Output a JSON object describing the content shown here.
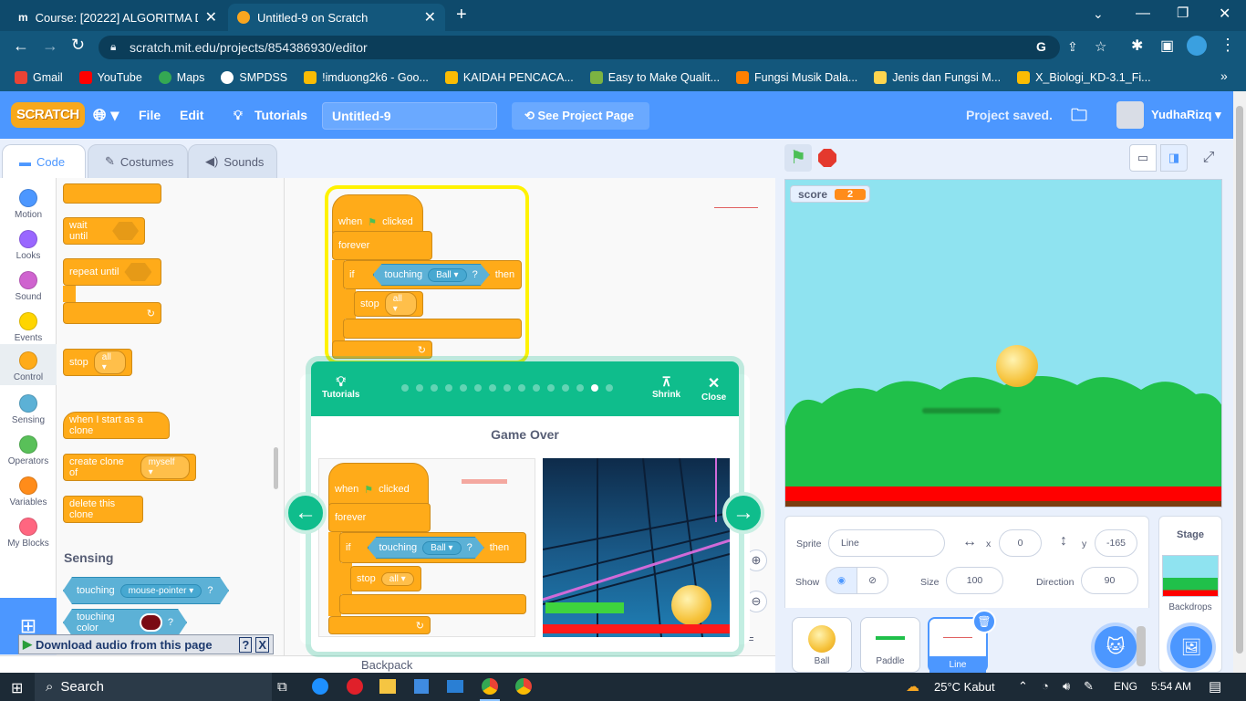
{
  "browser": {
    "tabs": [
      {
        "title": "Course: [20222] ALGORITMA DAN",
        "icon": "moodle-icon"
      },
      {
        "title": "Untitled-9 on Scratch",
        "icon": "scratch-icon"
      }
    ],
    "url": "scratch.mit.edu/projects/854386930/editor",
    "bookmarks": [
      "Gmail",
      "YouTube",
      "Maps",
      "SMPDSS",
      "!imduong2k6 - Goo...",
      "KAIDAH PENCACA...",
      "Easy to Make Qualit...",
      "Fungsi Musik Dala...",
      "Jenis dan Fungsi M...",
      "X_Biologi_KD-3.1_Fi..."
    ]
  },
  "menubar": {
    "logo": "SCRATCH",
    "file": "File",
    "edit": "Edit",
    "tutorials": "Tutorials",
    "project_title": "Untitled-9",
    "see_project": "See Project Page",
    "saved": "Project saved.",
    "username": "YudhaRizq"
  },
  "editor_tabs": {
    "code": "Code",
    "costumes": "Costumes",
    "sounds": "Sounds"
  },
  "categories": [
    {
      "label": "Motion",
      "color": "#4c97ff"
    },
    {
      "label": "Looks",
      "color": "#9966ff"
    },
    {
      "label": "Sound",
      "color": "#cf63cf"
    },
    {
      "label": "Events",
      "color": "#ffd500"
    },
    {
      "label": "Control",
      "color": "#ffab19"
    },
    {
      "label": "Sensing",
      "color": "#5cb1d6"
    },
    {
      "label": "Operators",
      "color": "#59c059"
    },
    {
      "label": "Variables",
      "color": "#ff8c1a"
    },
    {
      "label": "My Blocks",
      "color": "#ff6680"
    }
  ],
  "palette": {
    "wait_until": "wait until",
    "repeat_until": "repeat until",
    "stop": "stop",
    "stop_opt": "all",
    "when_clone": "when I start as a clone",
    "create_clone": "create clone of",
    "create_clone_opt": "myself",
    "delete_clone": "delete this clone",
    "sensing_heading": "Sensing",
    "touching": "touching",
    "touching_opt": "mouse-pointer",
    "q": "?",
    "touching_color": "touching color"
  },
  "script": {
    "when": "when",
    "clicked": "clicked",
    "forever": "forever",
    "if": "if",
    "touching": "touching",
    "sprite": "Ball",
    "q": "?",
    "then": "then",
    "stop": "stop",
    "stop_opt": "all"
  },
  "tutorial": {
    "tutorials": "Tutorials",
    "shrink": "Shrink",
    "close": "Close",
    "title": "Game Over",
    "steps": 15,
    "current_step": 14
  },
  "stage": {
    "score_label": "score",
    "score_value": "2"
  },
  "sprite_info": {
    "sprite_label": "Sprite",
    "sprite_name": "Line",
    "x_label": "x",
    "x": "0",
    "y_label": "y",
    "y": "-165",
    "show_label": "Show",
    "size_label": "Size",
    "size": "100",
    "direction_label": "Direction",
    "direction": "90"
  },
  "sprites": [
    "Ball",
    "Paddle",
    "Line"
  ],
  "stage_panel": {
    "title": "Stage",
    "backdrops": "Backdrops"
  },
  "backpack": "Backpack",
  "download_bar": "Download audio from this page",
  "taskbar": {
    "search": "Search",
    "weather": "25°C  Kabut",
    "lang": "ENG",
    "time": "5:54 AM"
  }
}
